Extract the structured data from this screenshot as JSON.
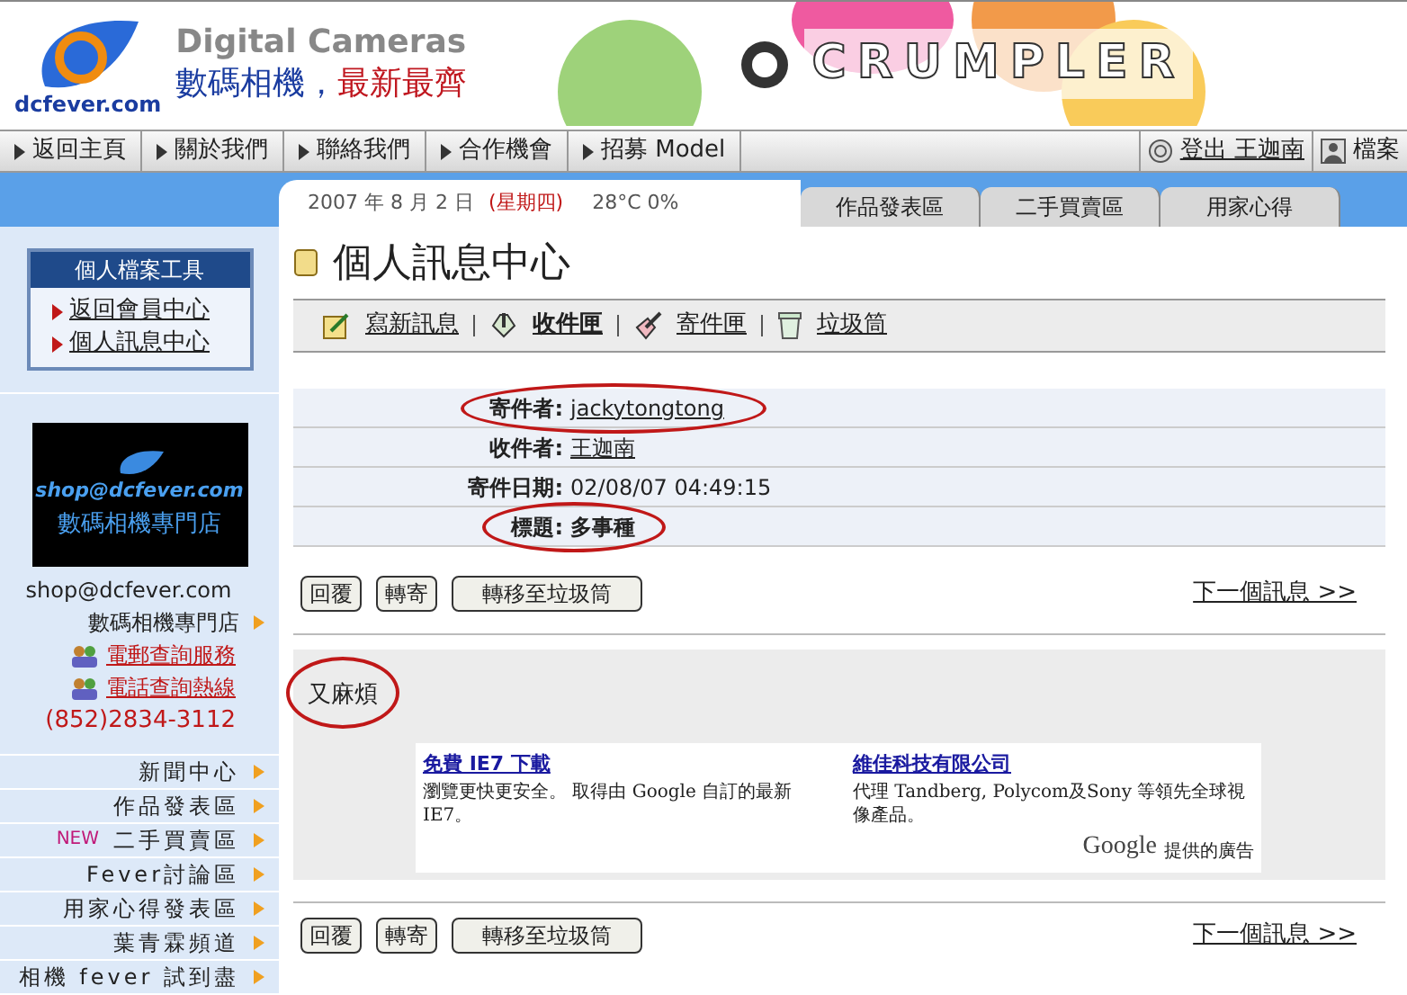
{
  "header": {
    "site": "dcfever.com",
    "heading": "Digital Cameras",
    "tagline_a": "數碼相機，",
    "tagline_b": "最新最齊",
    "banner": "CRUMPLER"
  },
  "nav": {
    "items": [
      "返回主頁",
      "關於我們",
      "聯絡我們",
      "合作機會",
      "招募 Model"
    ],
    "logout": "登出 王迦南",
    "profile": "檔案"
  },
  "date_bar": {
    "date": "2007 年 8 月 2 日",
    "weekday": "(星期四)",
    "weather": "28°C 0%"
  },
  "tabs": [
    {
      "label": "作品發表區",
      "selected": false
    },
    {
      "label": "二手買賣區",
      "selected": false
    },
    {
      "label": "用家心得",
      "selected": false
    }
  ],
  "sidebar": {
    "tool_title": "個人檔案工具",
    "tool_links": [
      "返回會員中心",
      "個人訊息中心"
    ],
    "shop_banner": "shop@dcfever.com",
    "shop_banner_sub": "數碼相機專門店",
    "shop_email": "shop@dcfever.com",
    "shop_name": "數碼相機專門店",
    "service_links": [
      "電郵查詢服務",
      "電話查詢熱線"
    ],
    "phone": "(852)2834-3112",
    "menu": [
      {
        "label": "新聞中心"
      },
      {
        "label": "作品發表區"
      },
      {
        "label": "二手買賣區",
        "badge": "NEW"
      },
      {
        "label": "Fever討論區"
      },
      {
        "label": "用家心得發表區"
      },
      {
        "label": "葉青霖頻道"
      },
      {
        "label": "相機 fever 試到盡"
      }
    ]
  },
  "page_title": "個人訊息中心",
  "toolbar": [
    {
      "label": "寫新訊息",
      "kind": "compose",
      "selected": false
    },
    {
      "label": "收件匣",
      "kind": "inbox",
      "selected": true
    },
    {
      "label": "寄件匣",
      "kind": "outbox",
      "selected": false
    },
    {
      "label": "垃圾筒",
      "kind": "trash",
      "selected": false
    }
  ],
  "message": {
    "fields": [
      {
        "label": "寄件者:",
        "value": "jackytongtong",
        "link": true,
        "circled": true
      },
      {
        "label": "收件者:",
        "value": "王迦南",
        "link": true,
        "circled": false
      },
      {
        "label": "寄件日期:",
        "value": "02/08/07 04:49:15",
        "link": false,
        "circled": false
      },
      {
        "label": "標題:",
        "value": "多事種",
        "link": false,
        "circled": true,
        "bold": true
      }
    ],
    "body": "又麻煩",
    "body_circled": true
  },
  "actions_top": [
    "回覆",
    "轉寄",
    "轉移至垃圾筒"
  ],
  "next_link_top": "下一個訊息 >>",
  "actions_bottom": [
    "回覆",
    "轉寄",
    "轉移至垃圾筒"
  ],
  "next_link_bottom": "下一個訊息 >>",
  "ads": [
    {
      "title": "免費 IE7 下載",
      "text": "瀏覽更快更安全。 取得由 Google 自訂的最新 IE7。"
    },
    {
      "title": "維佳科技有限公司",
      "text": "代理 Tandberg, Polycom及Sony 等領先全球視像產品。"
    }
  ],
  "ads_brand": "Google",
  "ads_caption": "提供的廣告"
}
